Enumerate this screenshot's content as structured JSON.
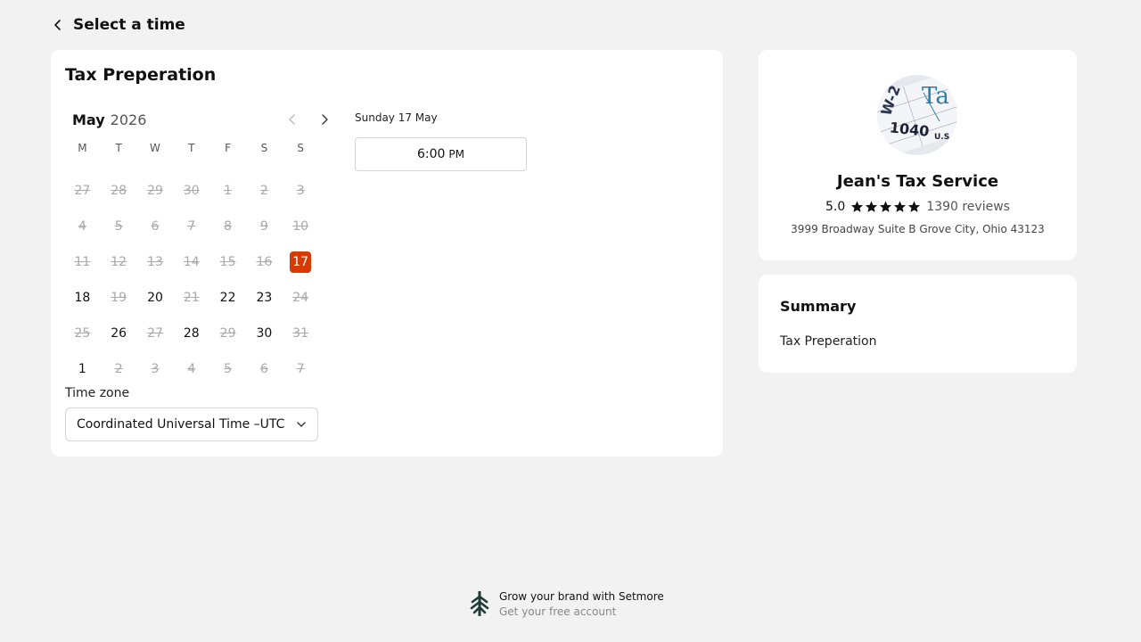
{
  "header": {
    "title": "Select a time"
  },
  "service": {
    "title": "Tax Preperation"
  },
  "calendar": {
    "month": "May",
    "year": "2026",
    "weekdays": [
      "M",
      "T",
      "W",
      "T",
      "F",
      "S",
      "S"
    ],
    "days": [
      {
        "d": "27",
        "s": "off"
      },
      {
        "d": "28",
        "s": "off"
      },
      {
        "d": "29",
        "s": "off"
      },
      {
        "d": "30",
        "s": "off"
      },
      {
        "d": "1",
        "s": "off"
      },
      {
        "d": "2",
        "s": "off"
      },
      {
        "d": "3",
        "s": "off"
      },
      {
        "d": "4",
        "s": "off"
      },
      {
        "d": "5",
        "s": "off"
      },
      {
        "d": "6",
        "s": "off"
      },
      {
        "d": "7",
        "s": "off"
      },
      {
        "d": "8",
        "s": "off"
      },
      {
        "d": "9",
        "s": "off"
      },
      {
        "d": "10",
        "s": "off"
      },
      {
        "d": "11",
        "s": "off"
      },
      {
        "d": "12",
        "s": "off"
      },
      {
        "d": "13",
        "s": "off"
      },
      {
        "d": "14",
        "s": "off"
      },
      {
        "d": "15",
        "s": "off"
      },
      {
        "d": "16",
        "s": "off"
      },
      {
        "d": "17",
        "s": "selected"
      },
      {
        "d": "18",
        "s": "avail"
      },
      {
        "d": "19",
        "s": "off"
      },
      {
        "d": "20",
        "s": "avail"
      },
      {
        "d": "21",
        "s": "off"
      },
      {
        "d": "22",
        "s": "avail"
      },
      {
        "d": "23",
        "s": "avail"
      },
      {
        "d": "24",
        "s": "off"
      },
      {
        "d": "25",
        "s": "off"
      },
      {
        "d": "26",
        "s": "avail"
      },
      {
        "d": "27",
        "s": "off"
      },
      {
        "d": "28",
        "s": "avail"
      },
      {
        "d": "29",
        "s": "off"
      },
      {
        "d": "30",
        "s": "avail"
      },
      {
        "d": "31",
        "s": "off"
      },
      {
        "d": "1",
        "s": "avail"
      },
      {
        "d": "2",
        "s": "off"
      },
      {
        "d": "3",
        "s": "off"
      },
      {
        "d": "4",
        "s": "off"
      },
      {
        "d": "5",
        "s": "off"
      },
      {
        "d": "6",
        "s": "off"
      },
      {
        "d": "7",
        "s": "off"
      }
    ]
  },
  "slots": {
    "date_label": "Sunday 17 May",
    "items": [
      {
        "time": "6:00",
        "ampm": "PM"
      }
    ]
  },
  "timezone": {
    "label": "Time zone",
    "value": "Coordinated Universal Time –UTC"
  },
  "business": {
    "name": "Jean's Tax Service",
    "rating": "5.0",
    "reviews": "1390 reviews",
    "address": "3999 Broadway Suite B Grove City, Ohio 43123"
  },
  "summary": {
    "title": "Summary",
    "item": "Tax Preperation"
  },
  "footer": {
    "line1": "Grow your brand with Setmore",
    "line2": "Get your free account"
  },
  "colors": {
    "accent": "#d63a00",
    "background": "#f2f2f2",
    "logo": "#1f3b33"
  }
}
